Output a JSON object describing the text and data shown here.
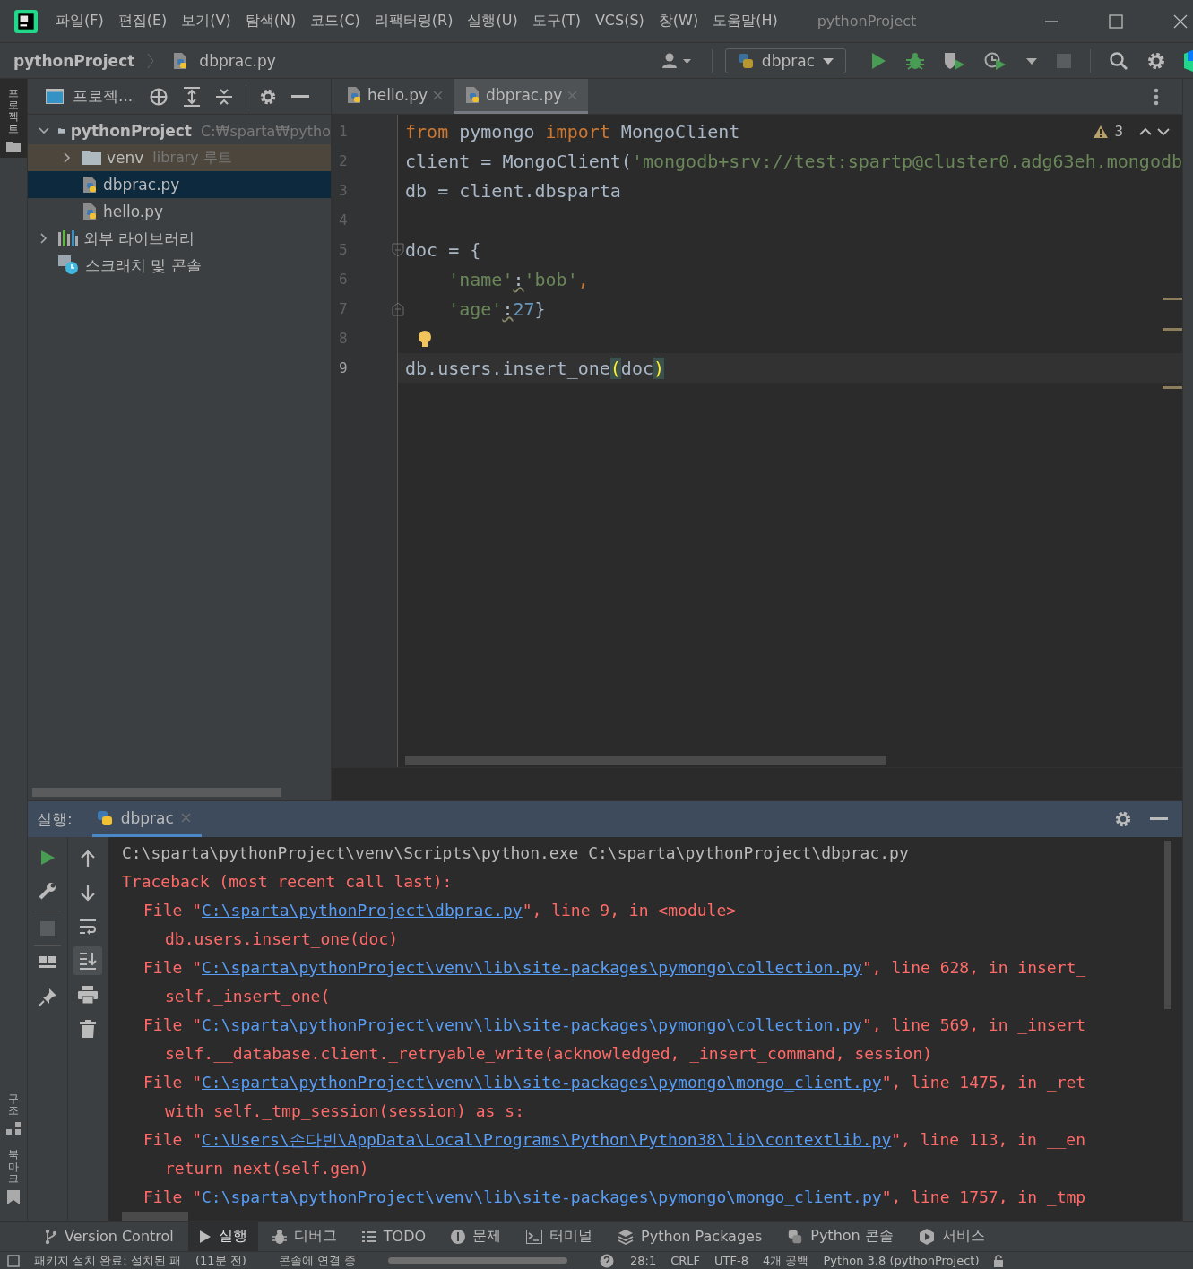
{
  "window": {
    "title": "pythonProject",
    "menu": [
      "파일(F)",
      "편집(E)",
      "보기(V)",
      "탐색(N)",
      "코드(C)",
      "리팩터링(R)",
      "실행(U)",
      "도구(T)",
      "VCS(S)",
      "창(W)",
      "도움말(H)"
    ]
  },
  "navigation": {
    "breadcrumb": [
      "pythonProject",
      "dbprac.py"
    ],
    "run_config": "dbprac"
  },
  "left_stripe": {
    "top": [
      {
        "label": "프로젝트",
        "selected": true
      }
    ],
    "bottom": [
      {
        "label": "구조",
        "kind": "structure"
      },
      {
        "label": "북마크",
        "kind": "bookmark"
      }
    ]
  },
  "project_panel": {
    "title": "프로젝...",
    "tree": [
      {
        "name": "pythonProject",
        "path": "C:₩sparta₩pytho",
        "kind": "folder",
        "expanded": true,
        "selected": false,
        "children": [
          {
            "name": "venv",
            "hint": "library 루트",
            "kind": "library_folder",
            "expanded": false,
            "selected": false
          },
          {
            "name": "dbprac.py",
            "kind": "python_file",
            "selected": true
          },
          {
            "name": "hello.py",
            "kind": "python_file",
            "selected": false
          }
        ]
      },
      {
        "name": "외부 라이브러리",
        "kind": "libraries",
        "expanded": false,
        "selected": false
      },
      {
        "name": "스크래치 및 콘솔",
        "kind": "scratches",
        "selected": false
      }
    ]
  },
  "editor": {
    "tabs": [
      {
        "label": "hello.py",
        "selected": false
      },
      {
        "label": "dbprac.py",
        "selected": true
      }
    ],
    "warnings": "3",
    "lines": [
      {
        "number": "1",
        "kind": "plain",
        "current": false,
        "bulb": false,
        "tokens": [
          {
            "text": "from",
            "kind": "keyword"
          },
          {
            "text": " pymongo ",
            "kind": "identifier"
          },
          {
            "text": "import",
            "kind": "keyword"
          },
          {
            "text": " MongoClient",
            "kind": "identifier"
          }
        ]
      },
      {
        "number": "2",
        "kind": "plain",
        "current": false,
        "bulb": false,
        "tokens": [
          {
            "text": "client = MongoClient(",
            "kind": "identifier"
          },
          {
            "text": "'mongodb+srv://test:spartp@cluster0.adg63eh.mongodb",
            "kind": "string"
          }
        ]
      },
      {
        "number": "3",
        "kind": "plain",
        "current": false,
        "bulb": false,
        "tokens": [
          {
            "text": "db = client.dbsparta",
            "kind": "identifier"
          }
        ]
      },
      {
        "number": "4",
        "kind": "plain",
        "current": false,
        "bulb": false
      },
      {
        "number": "5",
        "kind": "fold_start",
        "current": false,
        "bulb": false,
        "tokens": [
          {
            "text": "doc = {",
            "kind": "identifier"
          }
        ]
      },
      {
        "number": "6",
        "kind": "plain",
        "current": false,
        "bulb": false,
        "tokens": [
          {
            "text": "    'name'",
            "kind": "string"
          },
          {
            "text": ":",
            "kind": "warning"
          },
          {
            "text": "'bob'",
            "kind": "string"
          },
          {
            "text": ",",
            "kind": "keyword"
          }
        ]
      },
      {
        "number": "7",
        "kind": "fold_end",
        "current": false,
        "bulb": false,
        "tokens": [
          {
            "text": "    'age'",
            "kind": "string"
          },
          {
            "text": ":",
            "kind": "warning"
          },
          {
            "text": "27",
            "kind": "number"
          },
          {
            "text": "}",
            "kind": "identifier"
          }
        ]
      },
      {
        "number": "8",
        "kind": "plain",
        "current": false,
        "bulb": true
      },
      {
        "number": "9",
        "kind": "plain",
        "current": true,
        "bulb": false,
        "tokens": [
          {
            "text": "db.users.insert_one",
            "kind": "identifier"
          },
          {
            "text": "(",
            "kind": "brace_match"
          },
          {
            "text": "doc",
            "kind": "identifier"
          },
          {
            "text": ")",
            "kind": "brace_match"
          }
        ]
      }
    ]
  },
  "run_panel": {
    "label": "실행:",
    "tabs": [
      {
        "label": "dbprac",
        "selected": true
      }
    ],
    "console": [
      {
        "kind": "command",
        "segments": [
          {
            "text": "C:\\sparta\\pythonProject\\venv\\Scripts\\python.exe C:\\sparta\\pythonProject\\dbprac.py",
            "kind": "output"
          }
        ]
      },
      {
        "kind": "header",
        "segments": [
          {
            "text": "Traceback (most recent call last):",
            "kind": "error"
          }
        ]
      },
      {
        "kind": "frame",
        "segments": [
          {
            "text": "File \"",
            "kind": "error"
          },
          {
            "text": "C:\\sparta\\pythonProject\\dbprac.py",
            "kind": "link"
          },
          {
            "text": "\", line 9, in <module>",
            "kind": "error"
          }
        ]
      },
      {
        "kind": "source",
        "segments": [
          {
            "text": "db.users.insert_one(doc)",
            "kind": "error"
          }
        ]
      },
      {
        "kind": "frame",
        "segments": [
          {
            "text": "File \"",
            "kind": "error"
          },
          {
            "text": "C:\\sparta\\pythonProject\\venv\\lib\\site-packages\\pymongo\\collection.py",
            "kind": "link"
          },
          {
            "text": "\", line 628, in insert_",
            "kind": "error"
          }
        ]
      },
      {
        "kind": "source",
        "segments": [
          {
            "text": "self._insert_one(",
            "kind": "error"
          }
        ]
      },
      {
        "kind": "frame",
        "segments": [
          {
            "text": "File \"",
            "kind": "error"
          },
          {
            "text": "C:\\sparta\\pythonProject\\venv\\lib\\site-packages\\pymongo\\collection.py",
            "kind": "link"
          },
          {
            "text": "\", line 569, in _insert",
            "kind": "error"
          }
        ]
      },
      {
        "kind": "source",
        "segments": [
          {
            "text": "self.__database.client._retryable_write(acknowledged, _insert_command, session)",
            "kind": "error"
          }
        ]
      },
      {
        "kind": "frame",
        "segments": [
          {
            "text": "File \"",
            "kind": "error"
          },
          {
            "text": "C:\\sparta\\pythonProject\\venv\\lib\\site-packages\\pymongo\\mongo_client.py",
            "kind": "link"
          },
          {
            "text": "\", line 1475, in _ret",
            "kind": "error"
          }
        ]
      },
      {
        "kind": "source",
        "segments": [
          {
            "text": "with self._tmp_session(session) as s:",
            "kind": "error"
          }
        ]
      },
      {
        "kind": "frame",
        "segments": [
          {
            "text": "File \"",
            "kind": "error"
          },
          {
            "text": "C:\\Users\\손다빈\\AppData\\Local\\Programs\\Python\\Python38\\lib\\contextlib.py",
            "kind": "link"
          },
          {
            "text": "\", line 113, in __en",
            "kind": "error"
          }
        ]
      },
      {
        "kind": "source",
        "segments": [
          {
            "text": "return next(self.gen)",
            "kind": "error"
          }
        ]
      },
      {
        "kind": "frame",
        "segments": [
          {
            "text": "File \"",
            "kind": "error"
          },
          {
            "text": "C:\\sparta\\pythonProject\\venv\\lib\\site-packages\\pymongo\\mongo_client.py",
            "kind": "link"
          },
          {
            "text": "\", line 1757, in _tmp",
            "kind": "error"
          }
        ]
      }
    ]
  },
  "tool_windows": [
    {
      "label": "Version Control",
      "selected": false
    },
    {
      "label": "실행",
      "selected": true
    },
    {
      "label": "디버그",
      "selected": false
    },
    {
      "label": "TODO",
      "selected": false
    },
    {
      "label": "문제",
      "selected": false
    },
    {
      "label": "터미널",
      "selected": false
    },
    {
      "label": "Python Packages",
      "selected": false
    },
    {
      "label": "Python 콘솔",
      "selected": false
    },
    {
      "label": "서비스",
      "selected": false
    }
  ],
  "status_bar": {
    "message": "패키지 설치 완료: 설치된 패",
    "age": "(11분 전)",
    "task": "콘솔에 연결 중",
    "position": "28:1",
    "line_separator": "CRLF",
    "encoding": "UTF-8",
    "indent": "4개 공백",
    "interpreter": "Python 3.8 (pythonProject)"
  }
}
